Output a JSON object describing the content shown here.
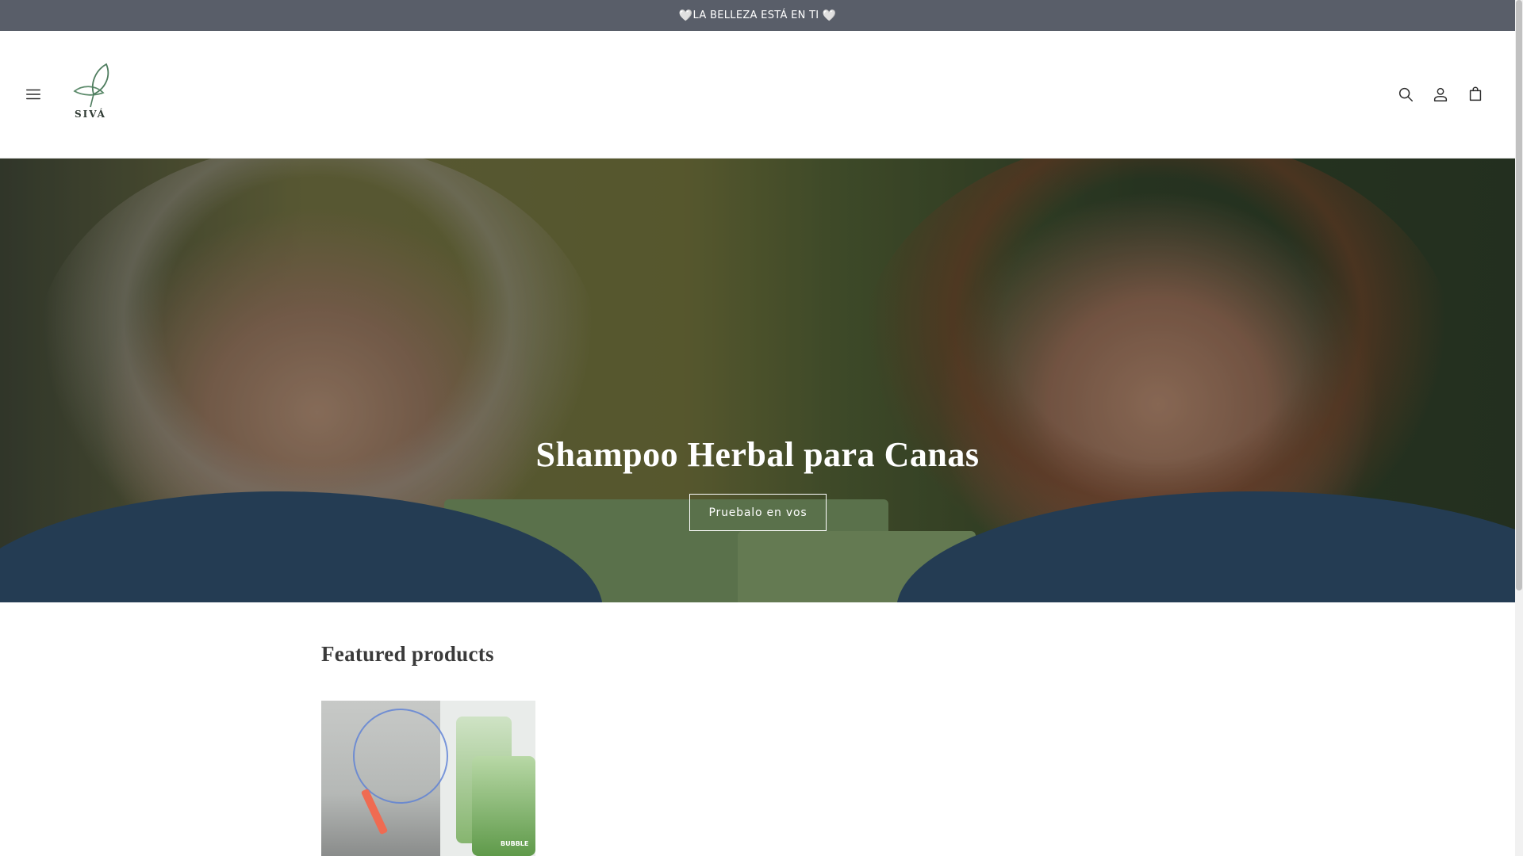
{
  "announcement": {
    "text": "LA BELLEZA ESTÁ EN TI",
    "heart_left": "🤍",
    "heart_right": "🤍"
  },
  "header": {
    "logo_text": "SIVÁ",
    "icons": [
      "menu-icon",
      "search-icon",
      "account-icon",
      "cart-icon"
    ]
  },
  "hero": {
    "title": "Shampoo Herbal para Canas",
    "button_label": "Pruebalo en vos"
  },
  "featured": {
    "title": "Featured products",
    "product_image_label": "BUBBLE"
  },
  "colors": {
    "announcement_bg": "#595e69",
    "logo_leaf": "#5b8a6a",
    "text_dark": "#121212"
  }
}
